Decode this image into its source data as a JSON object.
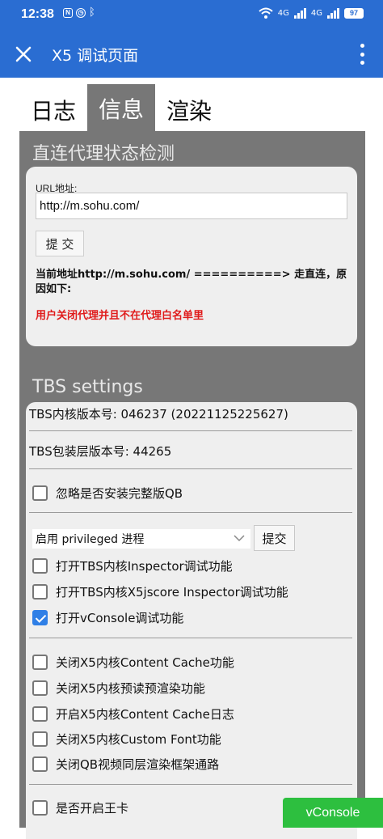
{
  "status_bar": {
    "time": "12:38",
    "battery": "97",
    "net_badge_1": "4G",
    "net_badge_2": "4G"
  },
  "app_bar": {
    "title": "X5 调试页面"
  },
  "tabs": [
    {
      "label": "日志",
      "active": false
    },
    {
      "label": "信息",
      "active": true
    },
    {
      "label": "渲染",
      "active": false
    }
  ],
  "proxy": {
    "section_title": "直连代理状态检测",
    "url_label": "URL地址:",
    "url_value": "http://m.sohu.com/",
    "submit_label": "提 交",
    "address_text": "当前地址http://m.sohu.com/ ==========> 走直连，原因如下:",
    "reason_text": "用户关闭代理并且不在代理白名单里"
  },
  "tbs": {
    "section_title": "TBS settings",
    "core_version": "TBS内核版本号: 046237 (20221125225627)",
    "shell_version": "TBS包装层版本号: 44265",
    "ignore_qb_label": "忽略是否安装完整版QB",
    "select_value": "启用 privileged 进程",
    "select_submit": "提交",
    "options_a": [
      {
        "label": "打开TBS内核Inspector调试功能",
        "checked": false
      },
      {
        "label": "打开TBS内核X5jscore Inspector调试功能",
        "checked": false
      },
      {
        "label": "打开vConsole调试功能",
        "checked": true
      }
    ],
    "options_b": [
      {
        "label": "关闭X5内核Content Cache功能",
        "checked": false
      },
      {
        "label": "关闭X5内核预读预渲染功能",
        "checked": false
      },
      {
        "label": "开启X5内核Content Cache日志",
        "checked": false
      },
      {
        "label": "关闭X5内核Custom Font功能",
        "checked": false
      },
      {
        "label": "关闭QB视频同层渲染框架通路",
        "checked": false
      }
    ],
    "king_card_label": "是否开启王卡"
  },
  "vconsole_button": "vConsole",
  "colors": {
    "primary": "#2a6dd2",
    "panel": "#777777",
    "reason": "#e01b1b",
    "vconsole": "#2dbf3f",
    "checkbox": "#2f7fe6"
  }
}
